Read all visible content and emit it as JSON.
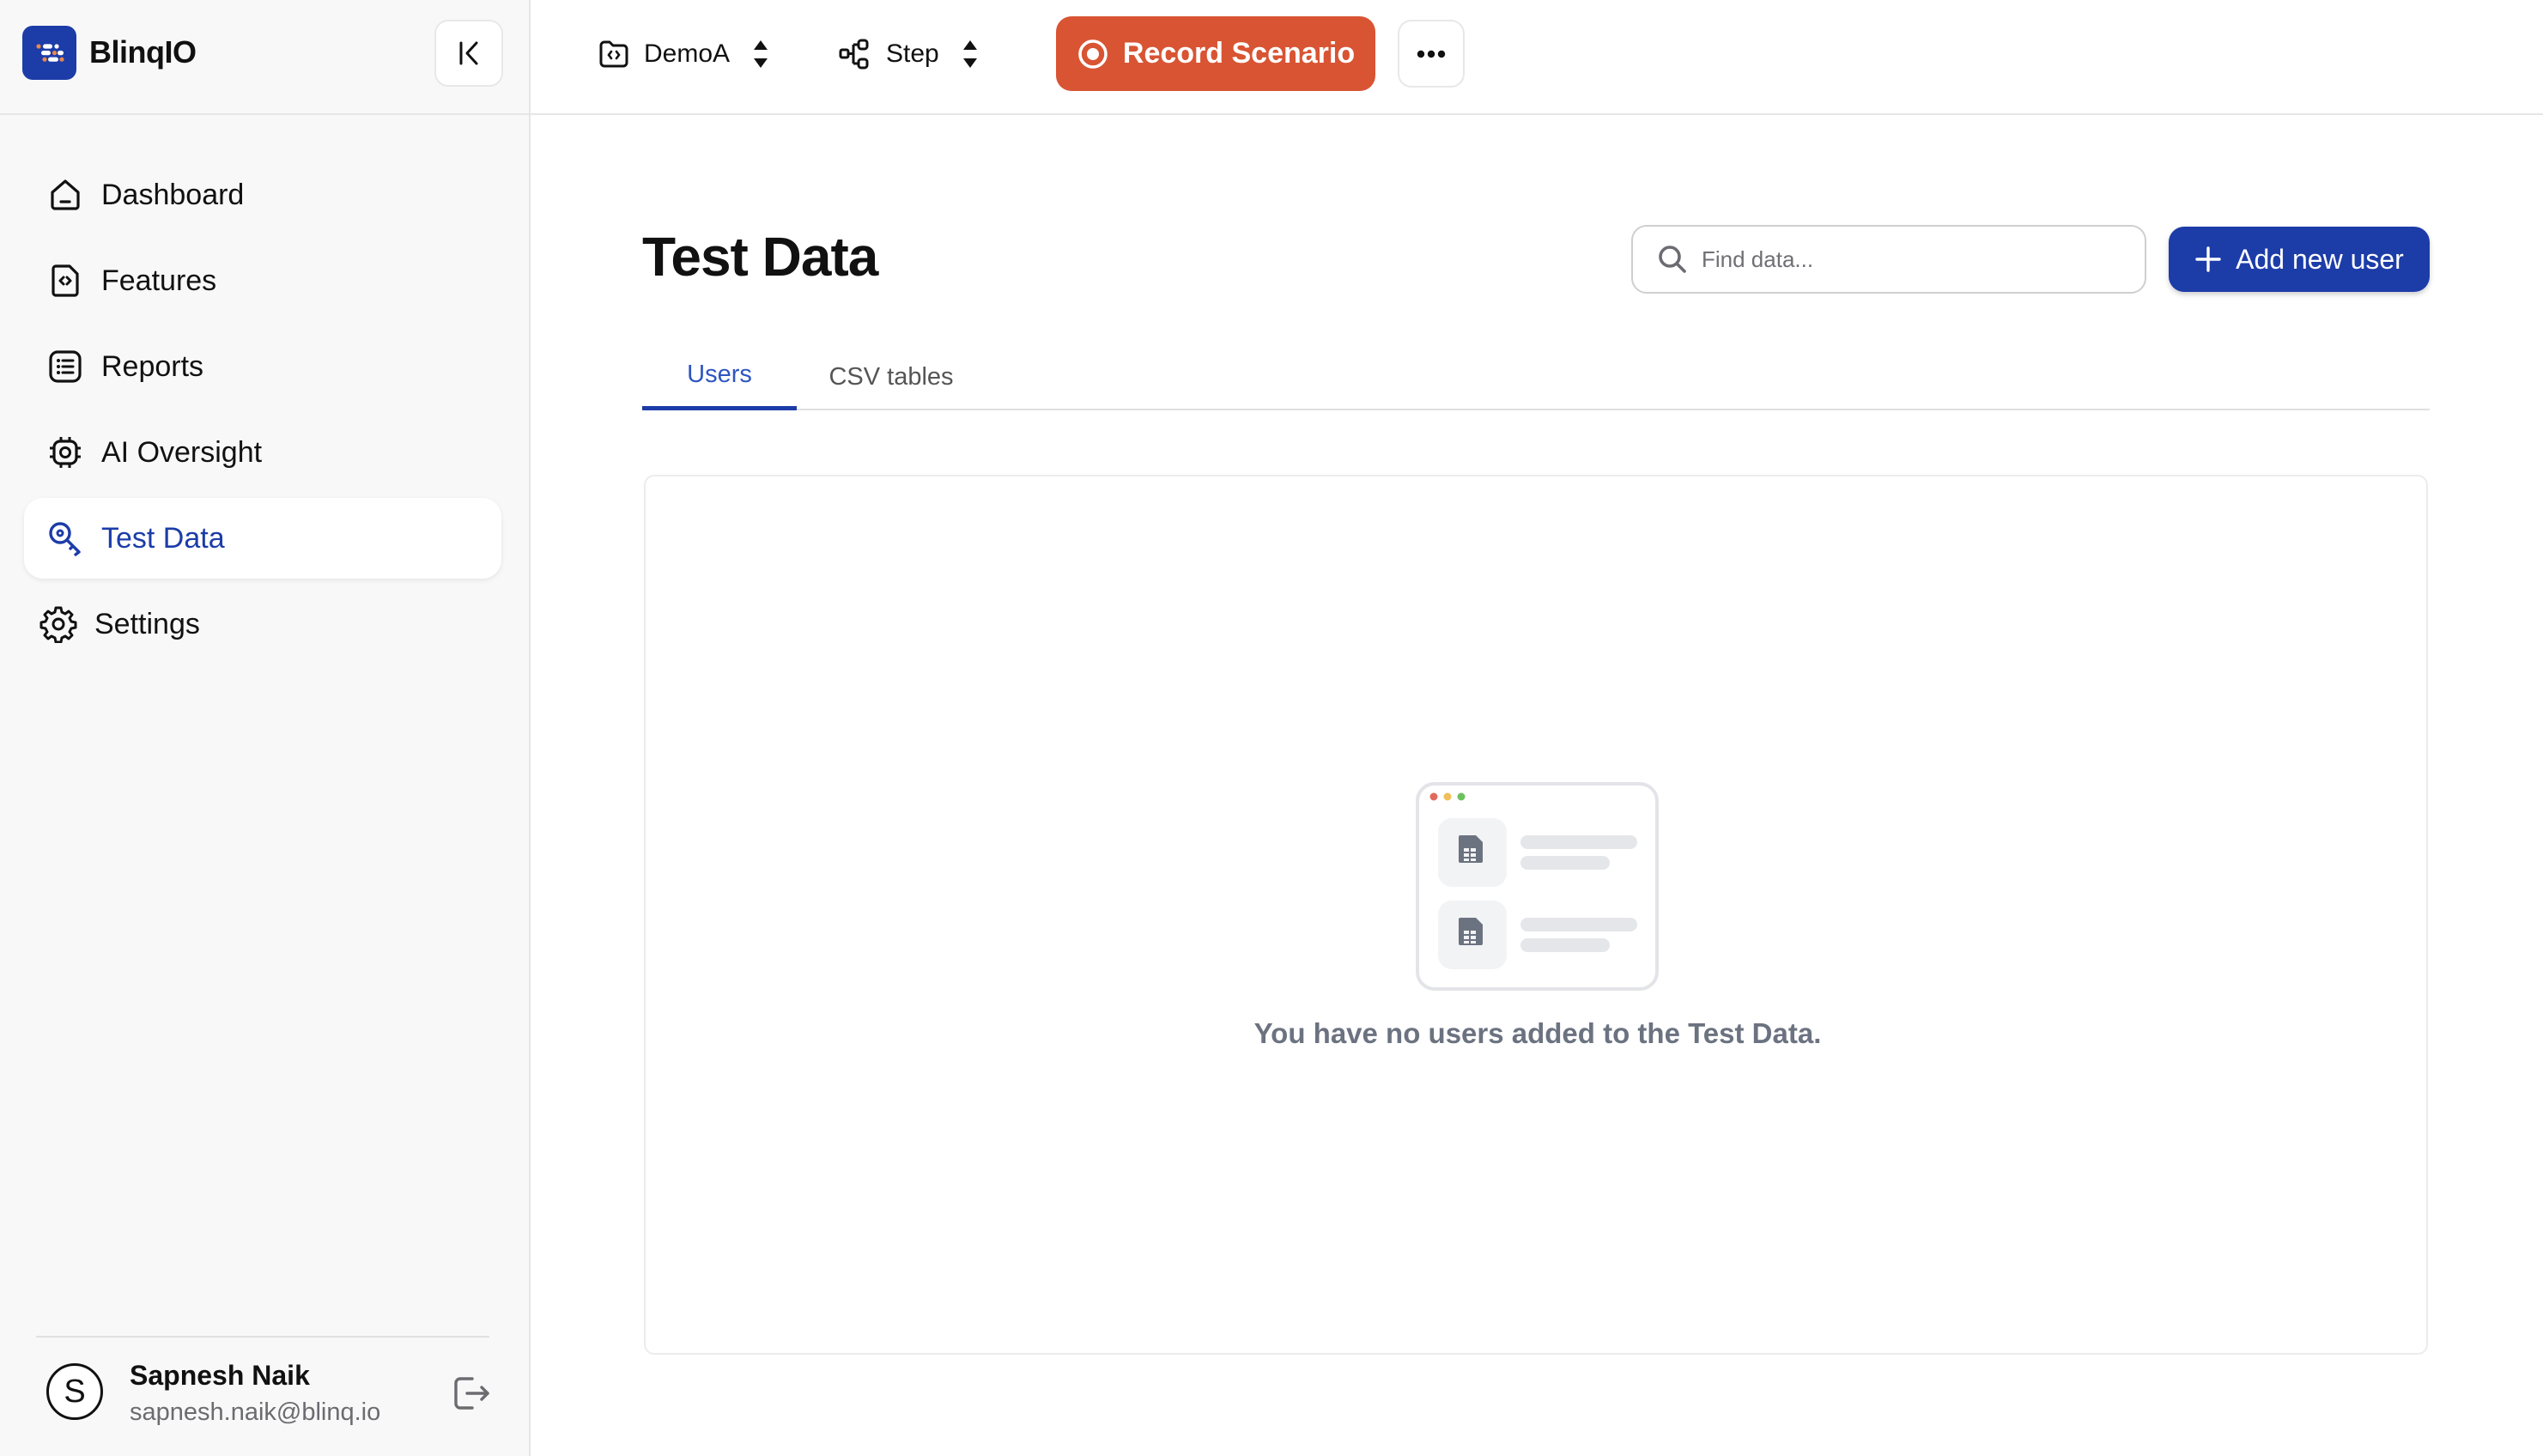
{
  "app": {
    "name": "BlinqIO",
    "brand_color": "#1c3ca8",
    "record_color": "#d85433"
  },
  "sidebar": {
    "collapse_icon": "collapse-left-icon",
    "items": [
      {
        "label": "Dashboard",
        "icon": "home-icon",
        "active": false
      },
      {
        "label": "Features",
        "icon": "code-file-icon",
        "active": false
      },
      {
        "label": "Reports",
        "icon": "list-icon",
        "active": false
      },
      {
        "label": "AI Oversight",
        "icon": "chip-icon",
        "active": false
      },
      {
        "label": "Test Data",
        "icon": "key-icon",
        "active": true
      },
      {
        "label": "Settings",
        "icon": "gear-icon",
        "active": false
      }
    ],
    "user": {
      "initial": "S",
      "name": "Sapnesh Naik",
      "email": "sapnesh.naik@blinq.io",
      "logout_icon": "logout-icon"
    }
  },
  "topbar": {
    "project_selector": {
      "label": "DemoA",
      "icon": "folder-code-icon"
    },
    "step_selector": {
      "label": "Step",
      "icon": "workflow-icon"
    },
    "record_button": "Record Scenario",
    "more_icon": "more-horizontal-icon"
  },
  "main": {
    "title": "Test Data",
    "search": {
      "placeholder": "Find data...",
      "value": ""
    },
    "add_button": "Add new user",
    "tabs": [
      {
        "label": "Users",
        "active": true
      },
      {
        "label": "CSV tables",
        "active": false
      }
    ],
    "empty_state": {
      "message": "You have no users added to the Test Data.",
      "illustration": "empty-files-illustration"
    }
  }
}
